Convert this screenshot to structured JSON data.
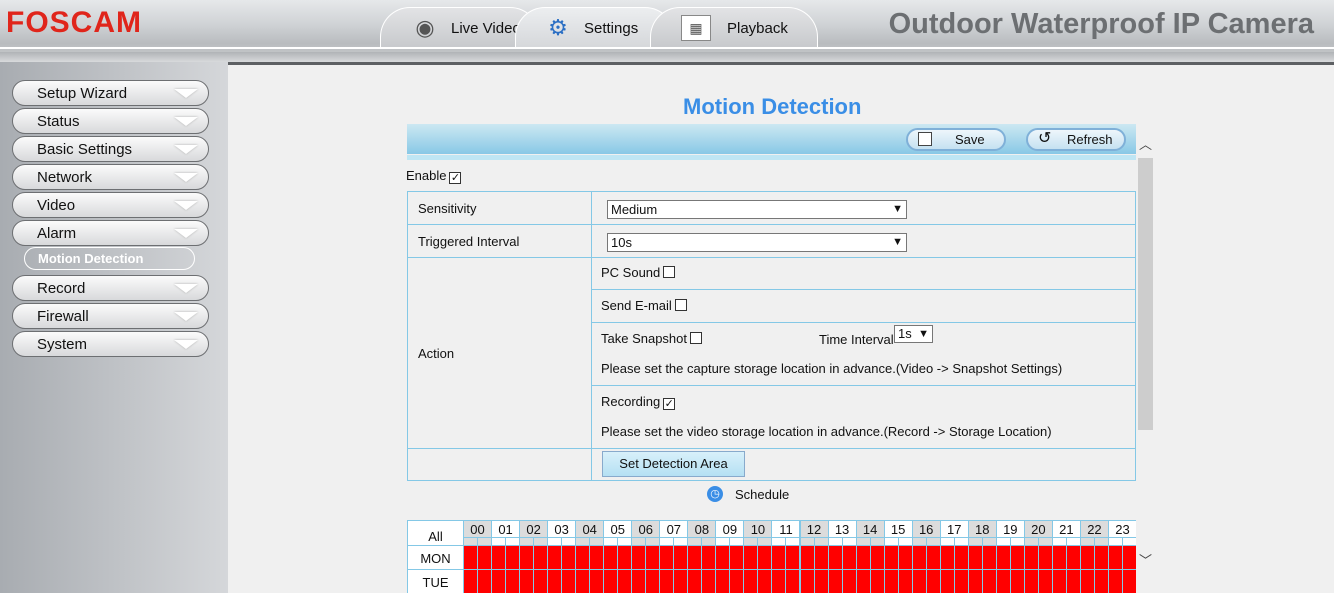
{
  "header": {
    "logo": "FOSCAM",
    "title": "Outdoor Waterproof IP Camera",
    "tabs": [
      {
        "label": "Live Video",
        "icon": "webcam-icon"
      },
      {
        "label": "Settings",
        "icon": "gears-icon"
      },
      {
        "label": "Playback",
        "icon": "calendar-icon"
      }
    ],
    "active_tab": "Settings"
  },
  "sidebar": {
    "items": [
      "Setup Wizard",
      "Status",
      "Basic Settings",
      "Network",
      "Video",
      "Alarm",
      "Record",
      "Firewall",
      "System"
    ],
    "active_sub": "Motion Detection"
  },
  "page": {
    "title": "Motion Detection",
    "save": "Save",
    "refresh": "Refresh",
    "enable_label": "Enable",
    "enable": true,
    "sensitivity_label": "Sensitivity",
    "sensitivity": "Medium",
    "interval_label": "Triggered Interval",
    "interval": "10s",
    "action_label": "Action",
    "pc_sound": "PC Sound",
    "pc_sound_checked": false,
    "send_email": "Send E-mail",
    "send_email_checked": false,
    "take_snapshot": "Take Snapshot",
    "take_snapshot_checked": false,
    "time_interval_label": "Time Interval",
    "time_interval": "1s",
    "snapshot_note": "Please set the capture storage location in advance.(Video -> Snapshot Settings)",
    "recording": "Recording",
    "recording_checked": true,
    "recording_note": "Please set the video storage location in advance.(Record -> Storage Location)",
    "set_area": "Set Detection Area",
    "schedule": "Schedule"
  },
  "schedule": {
    "all": "All",
    "hours": [
      "00",
      "01",
      "02",
      "03",
      "04",
      "05",
      "06",
      "07",
      "08",
      "09",
      "10",
      "11",
      "12",
      "13",
      "14",
      "15",
      "16",
      "17",
      "18",
      "19",
      "20",
      "21",
      "22",
      "23"
    ],
    "days": [
      "MON",
      "TUE"
    ],
    "active_color": "#ff0000",
    "all_slots_active": true
  },
  "colors": {
    "accent": "#3a8ee6",
    "logo": "#e0251b"
  }
}
